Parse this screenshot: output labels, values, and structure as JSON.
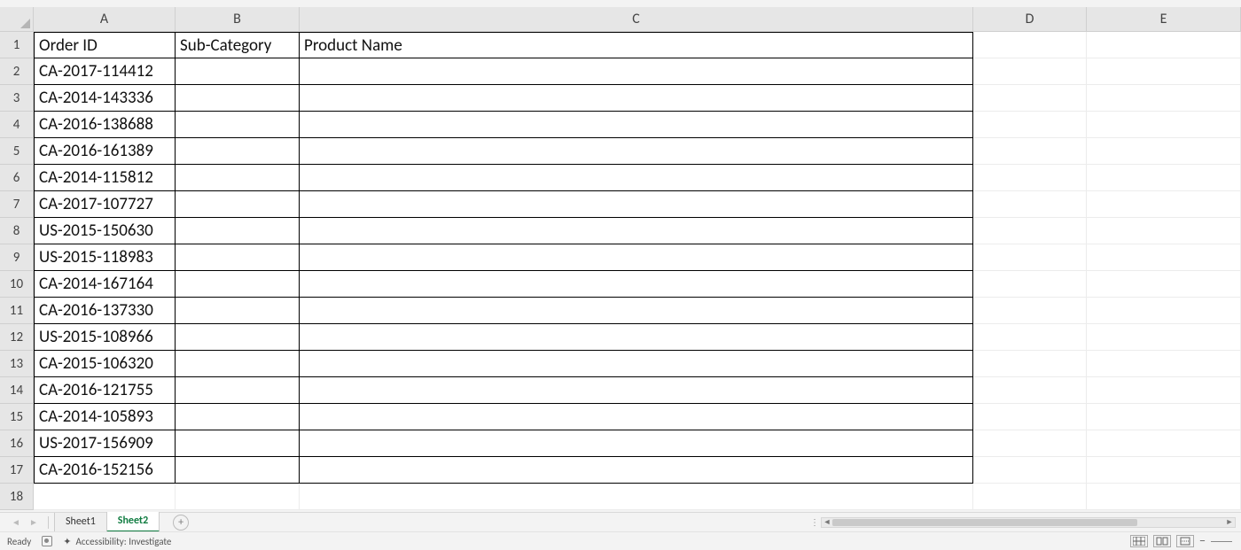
{
  "chart_data": {
    "type": "table",
    "columns": [
      "Order ID",
      "Sub-Category",
      "Product Name"
    ],
    "rows": [
      [
        "CA-2017-114412",
        "",
        ""
      ],
      [
        "CA-2014-143336",
        "",
        ""
      ],
      [
        "CA-2016-138688",
        "",
        ""
      ],
      [
        "CA-2016-161389",
        "",
        ""
      ],
      [
        "CA-2014-115812",
        "",
        ""
      ],
      [
        "CA-2017-107727",
        "",
        ""
      ],
      [
        "US-2015-150630",
        "",
        ""
      ],
      [
        "US-2015-118983",
        "",
        ""
      ],
      [
        "CA-2014-167164",
        "",
        ""
      ],
      [
        "CA-2016-137330",
        "",
        ""
      ],
      [
        "US-2015-108966",
        "",
        ""
      ],
      [
        "CA-2015-106320",
        "",
        ""
      ],
      [
        "CA-2016-121755",
        "",
        ""
      ],
      [
        "CA-2014-105893",
        "",
        ""
      ],
      [
        "US-2017-156909",
        "",
        ""
      ],
      [
        "CA-2016-152156",
        "",
        ""
      ]
    ]
  },
  "columns": {
    "letters": [
      "A",
      "B",
      "C",
      "D",
      "E"
    ]
  },
  "rows": {
    "numbers": [
      "1",
      "2",
      "3",
      "4",
      "5",
      "6",
      "7",
      "8",
      "9",
      "10",
      "11",
      "12",
      "13",
      "14",
      "15",
      "16",
      "17",
      "18"
    ]
  },
  "headers": {
    "A": "Order ID",
    "B": "Sub-Category",
    "C": "Product Name"
  },
  "data": {
    "A2": "CA-2017-114412",
    "A3": "CA-2014-143336",
    "A4": "CA-2016-138688",
    "A5": "CA-2016-161389",
    "A6": "CA-2014-115812",
    "A7": "CA-2017-107727",
    "A8": "US-2015-150630",
    "A9": "US-2015-118983",
    "A10": "CA-2014-167164",
    "A11": "CA-2016-137330",
    "A12": "US-2015-108966",
    "A13": "CA-2015-106320",
    "A14": "CA-2016-121755",
    "A15": "CA-2014-105893",
    "A16": "US-2017-156909",
    "A17": "CA-2016-152156"
  },
  "tabs": {
    "sheet1": "Sheet1",
    "sheet2": "Sheet2"
  },
  "status": {
    "ready": "Ready",
    "accessibility": "Accessibility: Investigate"
  }
}
